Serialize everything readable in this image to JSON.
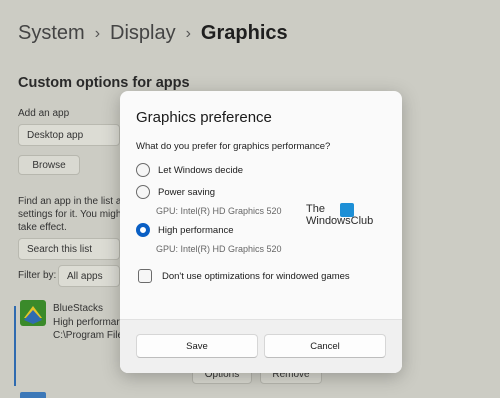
{
  "breadcrumb": {
    "root": "System",
    "middle": "Display",
    "current": "Graphics"
  },
  "section_title": "Custom options for apps",
  "add_app": {
    "label": "Add an app",
    "dropdown_value": "Desktop app",
    "browse_label": "Browse"
  },
  "find_text": {
    "line1": "Find an app in the list a",
    "line2": "settings for it. You migh",
    "line3": "take effect."
  },
  "search": {
    "placeholder": "Search this list"
  },
  "filter": {
    "label": "Filter by:",
    "value": "All apps"
  },
  "app_entry": {
    "name": "BlueStacks",
    "preference": "High performar",
    "path": "C:\\Program File"
  },
  "background_buttons": {
    "options": "Options",
    "remove": "Remove"
  },
  "dialog": {
    "title": "Graphics preference",
    "question": "What do you prefer for graphics performance?",
    "options": [
      {
        "label": "Let Windows decide",
        "checked": false,
        "gpu": ""
      },
      {
        "label": "Power saving",
        "checked": false,
        "gpu": "GPU: Intel(R) HD Graphics 520"
      },
      {
        "label": "High performance",
        "checked": true,
        "gpu": "GPU: Intel(R) HD Graphics 520"
      }
    ],
    "checkbox_label": "Don't use optimizations for windowed games",
    "checkbox_checked": false,
    "save_label": "Save",
    "cancel_label": "Cancel"
  },
  "watermark": {
    "line1": "The",
    "line2": "WindowsClub"
  },
  "colors": {
    "accent": "#0a5fc4",
    "overlay": "#a9a99b"
  }
}
